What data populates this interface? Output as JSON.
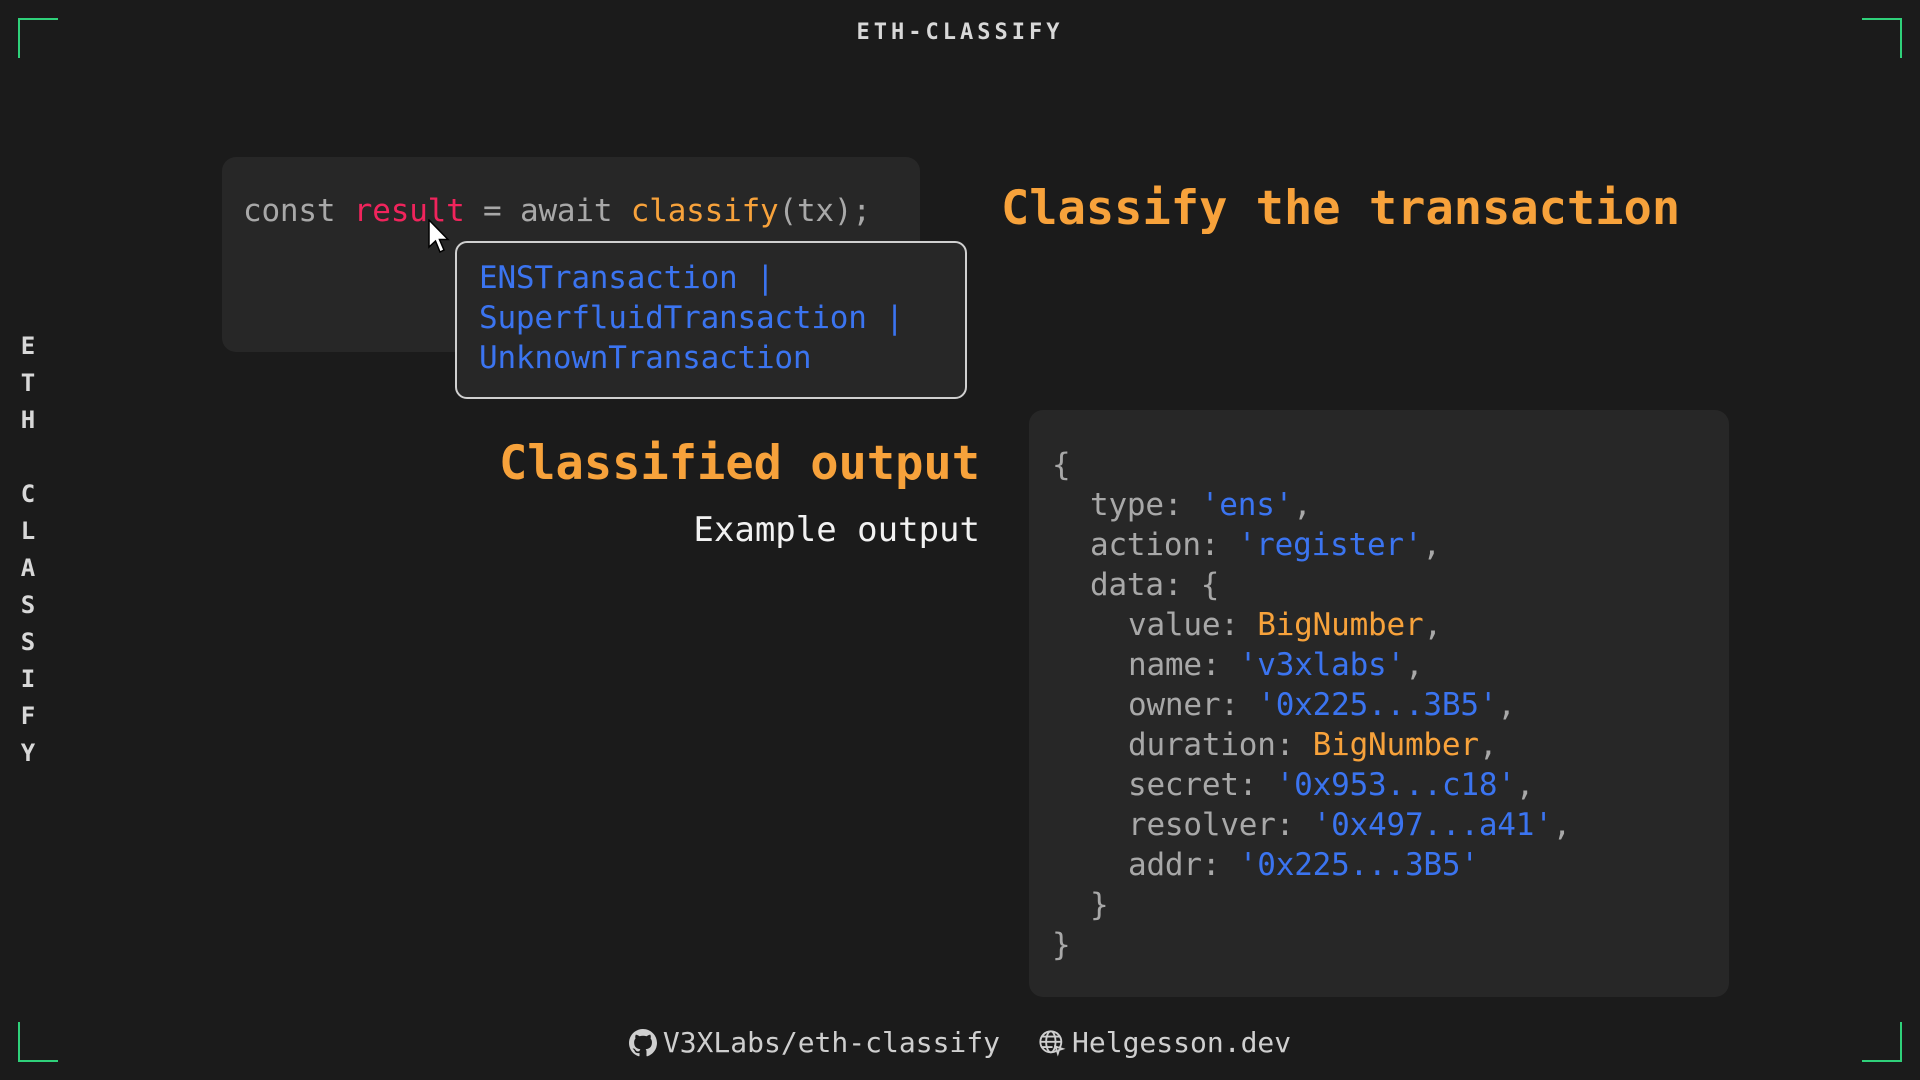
{
  "header": {
    "title": "ETH-CLASSIFY"
  },
  "side_letters": [
    "E",
    "T",
    "H",
    "",
    "C",
    "L",
    "A",
    "S",
    "S",
    "I",
    "F",
    "Y"
  ],
  "code": {
    "kw1": "const ",
    "var": "result",
    "op": " = await ",
    "fn": "classify",
    "rest": "(tx);"
  },
  "tooltip": {
    "lines": [
      "ENSTransaction |",
      "SuperfluidTransaction |",
      "UnknownTransaction"
    ]
  },
  "headings": {
    "classify": "Classify the transaction",
    "output": "Classified output",
    "example": "Example output"
  },
  "json_output": [
    {
      "indent": 0,
      "key": "{",
      "val": "",
      "type": "",
      "tail": ""
    },
    {
      "indent": 1,
      "key": "type: ",
      "val": "'ens'",
      "type": "str",
      "tail": ","
    },
    {
      "indent": 1,
      "key": "action: ",
      "val": "'register'",
      "type": "str",
      "tail": ","
    },
    {
      "indent": 1,
      "key": "data: {",
      "val": "",
      "type": "",
      "tail": ""
    },
    {
      "indent": 2,
      "key": "value: ",
      "val": "BigNumber",
      "type": "num",
      "tail": ","
    },
    {
      "indent": 2,
      "key": "name: ",
      "val": "'v3xlabs'",
      "type": "str",
      "tail": ","
    },
    {
      "indent": 2,
      "key": "owner: ",
      "val": "'0x225...3B5'",
      "type": "str",
      "tail": ","
    },
    {
      "indent": 2,
      "key": "duration: ",
      "val": "BigNumber",
      "type": "num",
      "tail": ","
    },
    {
      "indent": 2,
      "key": "secret: ",
      "val": "'0x953...c18'",
      "type": "str",
      "tail": ","
    },
    {
      "indent": 2,
      "key": "resolver: ",
      "val": "'0x497...a41'",
      "type": "str",
      "tail": ","
    },
    {
      "indent": 2,
      "key": "addr: ",
      "val": "'0x225...3B5'",
      "type": "str",
      "tail": ""
    },
    {
      "indent": 1,
      "key": "}",
      "val": "",
      "type": "",
      "tail": ""
    },
    {
      "indent": 0,
      "key": "}",
      "val": "",
      "type": "",
      "tail": ""
    }
  ],
  "footer": {
    "repo": "V3XLabs/eth-classify",
    "repo_icon": "github-icon",
    "site": "Helgesson.dev",
    "site_icon": "globe-icon"
  },
  "colors": {
    "accent_orange": "#f7a23b",
    "string_blue": "#3b74f0",
    "variable_red": "#f0245c",
    "corner_green": "#2fd07a",
    "background": "#1b1b1b",
    "panel": "#272727"
  }
}
